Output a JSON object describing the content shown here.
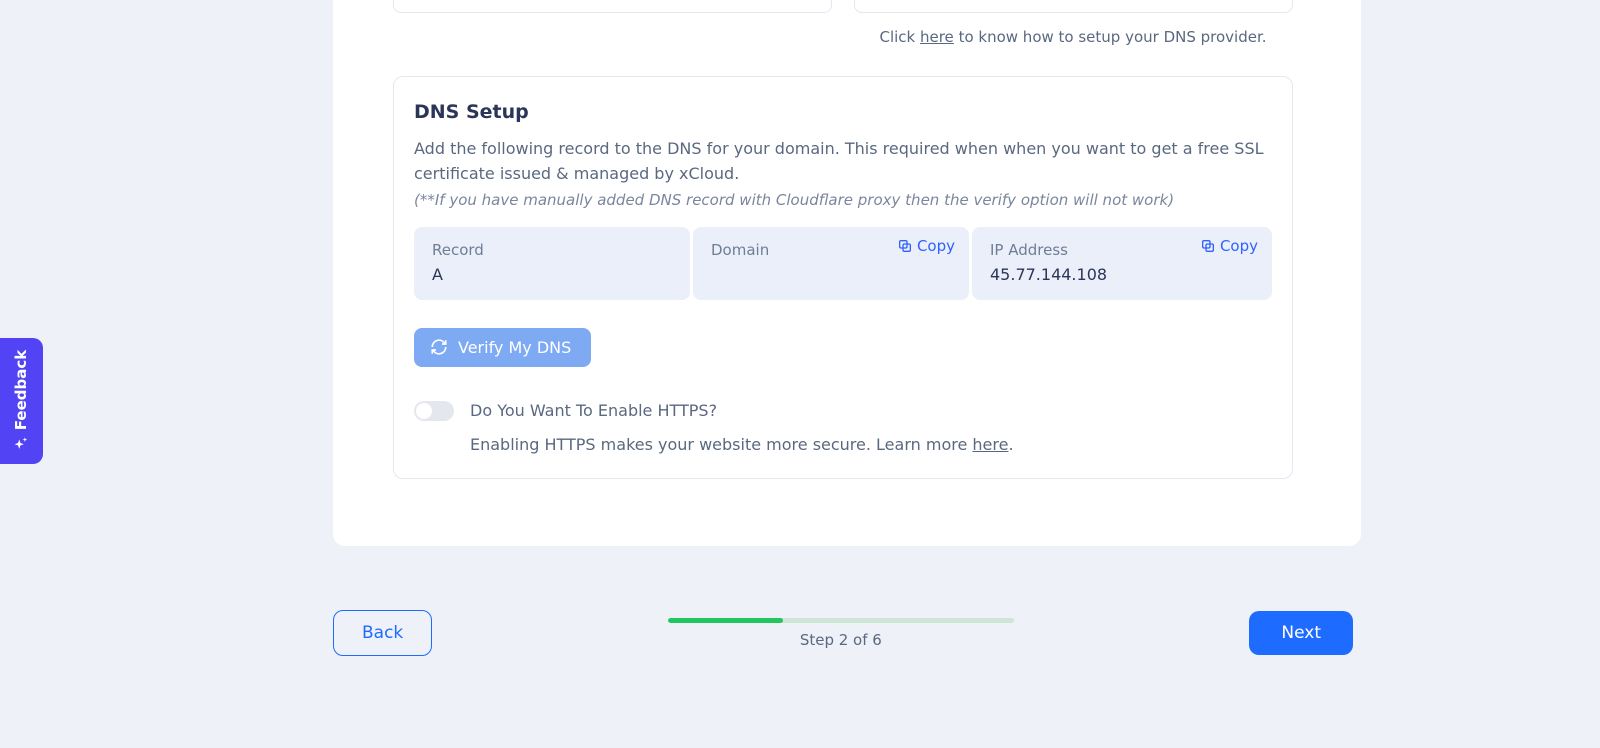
{
  "helper": {
    "prefix": "Click ",
    "link": "here",
    "suffix": " to know how to setup your DNS provider."
  },
  "dns": {
    "title": "DNS Setup",
    "description": "Add the following record to the DNS for your domain. This required when when you want to get a free SSL certificate issued & managed by xCloud.",
    "note": "(**If you have manually added DNS record with Cloudflare proxy then the verify option will not work)",
    "copy_label": "Copy",
    "record": {
      "label": "Record",
      "value": "A"
    },
    "domain": {
      "label": "Domain",
      "value": ""
    },
    "ip": {
      "label": "IP Address",
      "value": "45.77.144.108"
    },
    "verify_label": "Verify My DNS",
    "https_toggle_label": "Do You Want To Enable HTTPS?",
    "https_sub_prefix": "Enabling HTTPS makes your website more secure. Learn more ",
    "https_sub_link": "here",
    "https_sub_suffix": "."
  },
  "footer": {
    "back": "Back",
    "next": "Next",
    "progress_text": "Step 2 of 6",
    "current_step": 2,
    "total_steps": 6
  },
  "feedback": {
    "label": "Feedback"
  }
}
